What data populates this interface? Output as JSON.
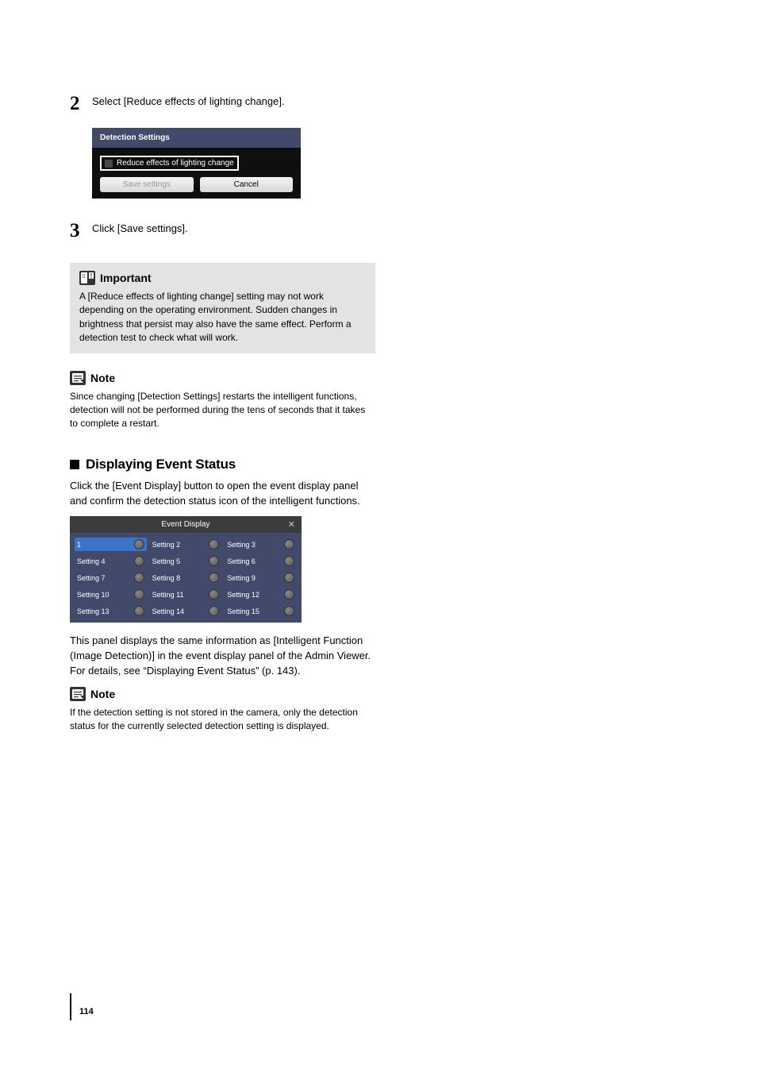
{
  "steps": {
    "s2": {
      "num": "2",
      "text": "Select [Reduce effects of lighting change]."
    },
    "s3": {
      "num": "3",
      "text": "Click [Save settings]."
    }
  },
  "detection_settings": {
    "title": "Detection Settings",
    "checkbox_label": "Reduce effects of lighting change",
    "save_btn": "Save settings",
    "cancel_btn": "Cancel"
  },
  "important": {
    "label": "Important",
    "body": "A [Reduce effects of lighting change] setting may not work depending on the operating environment. Sudden changes in brightness that persist may also have the same effect. Perform a detection test to check what will work."
  },
  "note1": {
    "label": "Note",
    "body": "Since changing [Detection Settings] restarts the intelligent functions, detection will not be performed during the tens of seconds that it takes to complete a restart."
  },
  "section": {
    "heading": "Displaying Event Status",
    "intro": "Click the [Event Display] button to open the event display panel and confirm the detection status icon of the intelligent functions."
  },
  "event_panel": {
    "title": "Event Display",
    "cells": [
      "1",
      "Setting 2",
      "Setting 3",
      "Setting 4",
      "Setting 5",
      "Setting 6",
      "Setting 7",
      "Setting 8",
      "Setting 9",
      "Setting 10",
      "Setting 11",
      "Setting 12",
      "Setting 13",
      "Setting 14",
      "Setting 15"
    ]
  },
  "after_panel": "This panel displays the same information as [Intelligent Function (Image Detection)] in the event display panel of the Admin Viewer. For details, see “Displaying Event Status” (p. 143).",
  "note2": {
    "label": "Note",
    "body": "If the detection setting is not stored in the camera, only the detection status for the currently selected detection setting is displayed."
  },
  "page_number": "114"
}
